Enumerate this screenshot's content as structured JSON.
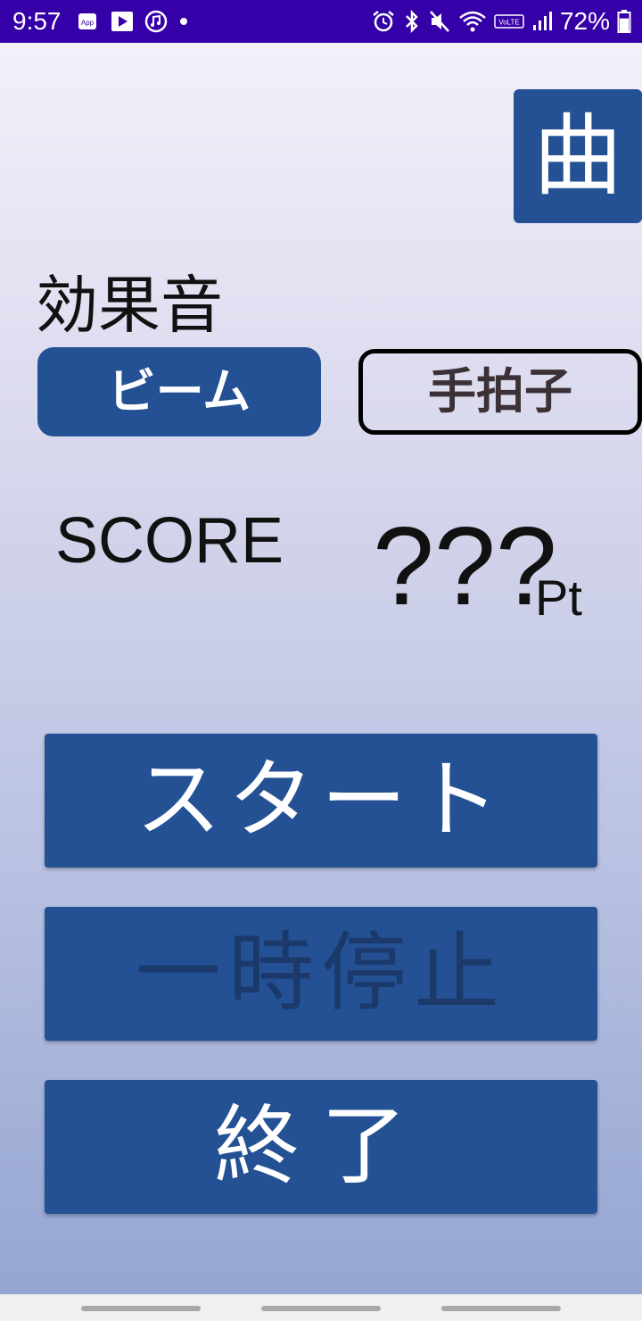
{
  "status_bar": {
    "time": "9:57",
    "battery_percent": "72%",
    "battery_level": 0.72,
    "background_color": "#3600a8",
    "left_icons": [
      "app-notification-icon",
      "play-store-icon",
      "music-app-icon",
      "more-dot-icon"
    ],
    "right_icons": [
      "alarm-icon",
      "bluetooth-icon",
      "mute-icon",
      "wifi-icon",
      "volte-icon",
      "signal-icon",
      "battery-icon"
    ],
    "volte_text": "VoLTE",
    "app_icon_text": "App"
  },
  "header": {
    "song_button_label": "曲"
  },
  "sound_effects": {
    "label": "効果音",
    "options": [
      {
        "label": "ビーム",
        "selected": true
      },
      {
        "label": "手拍子",
        "selected": false
      }
    ]
  },
  "score": {
    "label": "SCORE",
    "value": "???",
    "unit": "Pt"
  },
  "controls": {
    "start_label": "スタート",
    "pause_label": "一時停止",
    "end_label": "終了"
  },
  "colors": {
    "primary": "#245194",
    "disabled_text": "#1b3a6b",
    "gradient_top": "#f4f0fa",
    "gradient_bottom": "#95a6d2"
  }
}
